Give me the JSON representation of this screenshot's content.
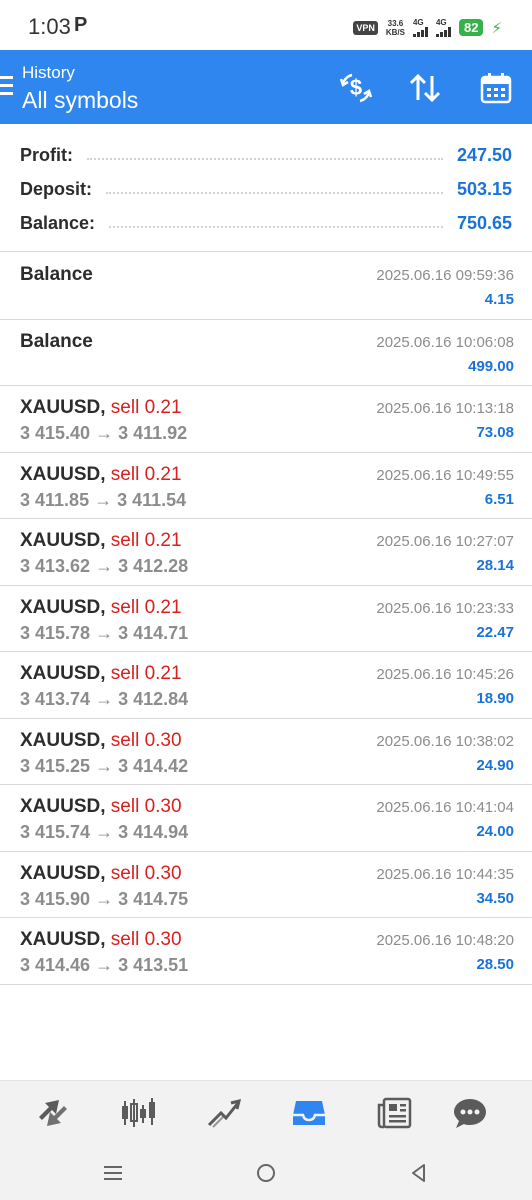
{
  "status_bar": {
    "time": "1:03",
    "carrier_glyph": "P",
    "vpn": "VPN",
    "speed_value": "33.6",
    "speed_unit": "KB/S",
    "sim1": "4G",
    "sim2": "4G",
    "battery": "82",
    "charging_icon": "bolt-icon"
  },
  "app_bar": {
    "subtitle": "History",
    "title": "All symbols",
    "icons": [
      "menu-icon",
      "currency-exchange-icon",
      "sort-icon",
      "calendar-icon"
    ]
  },
  "summary": {
    "profit_label": "Profit:",
    "profit_value": "247.50",
    "deposit_label": "Deposit:",
    "deposit_value": "503.15",
    "balance_label": "Balance:",
    "balance_value": "750.65"
  },
  "deals": [
    {
      "title": "Balance",
      "side": "",
      "prices": "",
      "time": "2025.06.16 09:59:36",
      "amount": "4.15"
    },
    {
      "title": "Balance",
      "side": "",
      "prices": "",
      "time": "2025.06.16 10:06:08",
      "amount": "499.00"
    },
    {
      "title": "XAUUSD,",
      "side": "sell 0.21",
      "prices": "3 415.40 → 3 411.92",
      "time": "2025.06.16 10:13:18",
      "amount": "73.08"
    },
    {
      "title": "XAUUSD,",
      "side": "sell 0.21",
      "prices": "3 411.85 → 3 411.54",
      "time": "2025.06.16 10:49:55",
      "amount": "6.51"
    },
    {
      "title": "XAUUSD,",
      "side": "sell 0.21",
      "prices": "3 413.62 → 3 412.28",
      "time": "2025.06.16 10:27:07",
      "amount": "28.14"
    },
    {
      "title": "XAUUSD,",
      "side": "sell 0.21",
      "prices": "3 415.78 → 3 414.71",
      "time": "2025.06.16 10:23:33",
      "amount": "22.47"
    },
    {
      "title": "XAUUSD,",
      "side": "sell 0.21",
      "prices": "3 413.74 → 3 412.84",
      "time": "2025.06.16 10:45:26",
      "amount": "18.90"
    },
    {
      "title": "XAUUSD,",
      "side": "sell 0.30",
      "prices": "3 415.25 → 3 414.42",
      "time": "2025.06.16 10:38:02",
      "amount": "24.90"
    },
    {
      "title": "XAUUSD,",
      "side": "sell 0.30",
      "prices": "3 415.74 → 3 414.94",
      "time": "2025.06.16 10:41:04",
      "amount": "24.00"
    },
    {
      "title": "XAUUSD,",
      "side": "sell 0.30",
      "prices": "3 415.90 → 3 414.75",
      "time": "2025.06.16 10:44:35",
      "amount": "34.50"
    },
    {
      "title": "XAUUSD,",
      "side": "sell 0.30",
      "prices": "3 414.46 → 3 413.51",
      "time": "2025.06.16 10:48:20",
      "amount": "28.50"
    }
  ],
  "bottom_nav": {
    "items": [
      "quotes-icon",
      "chart-icon",
      "trade-icon",
      "history-icon",
      "news-icon",
      "chat-icon"
    ],
    "active": "history-icon"
  },
  "system_nav": {
    "items": [
      "recents-icon",
      "home-icon",
      "back-icon"
    ]
  },
  "colors": {
    "accent": "#2f86ef",
    "profit_blue": "#1a73d9",
    "sell_red": "#d9211e",
    "nav_icon": "#5b5b5b"
  }
}
